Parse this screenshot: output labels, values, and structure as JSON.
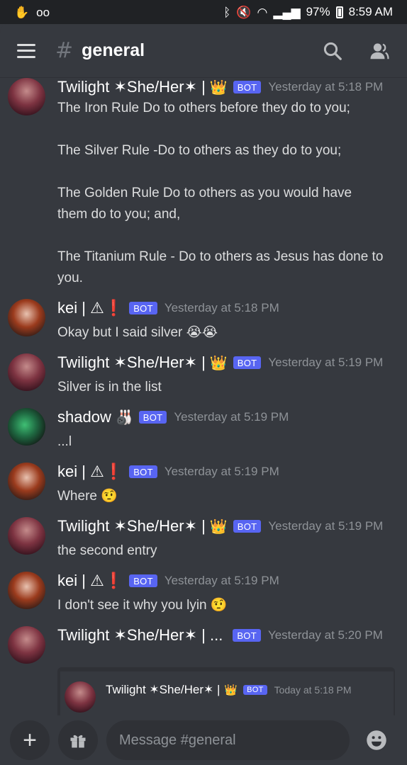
{
  "status_bar": {
    "battery": "97%",
    "time": "8:59 AM"
  },
  "header": {
    "channel_name": "general"
  },
  "messages": [
    {
      "username": "Twilight ✶She/Her✶ |",
      "badge": "BOT",
      "timestamp": "Yesterday at 5:18 PM",
      "lines": [
        "The Iron Rule Do to others before they do to you;",
        "",
        "The Silver Rule -Do to others as they do to you;",
        "",
        "The Golden Rule Do to others as you would have",
        "them do to you; and,",
        "",
        "The Titanium Rule - Do to others as Jesus has done to",
        "you."
      ]
    },
    {
      "username": "kei | ⚠❗",
      "badge": "BOT",
      "timestamp": "Yesterday at 5:18 PM",
      "text": "Okay but I said silver 😭😭"
    },
    {
      "username": "Twilight ✶She/Her✶ |",
      "badge": "BOT",
      "timestamp": "Yesterday at 5:19 PM",
      "text": "Silver is in the list"
    },
    {
      "username": "shadow",
      "badge": "BOT",
      "timestamp": "Yesterday at 5:19 PM",
      "text": "...l"
    },
    {
      "username": "kei | ⚠❗",
      "badge": "BOT",
      "timestamp": "Yesterday at 5:19 PM",
      "text": "Where 🤨"
    },
    {
      "username": "Twilight ✶She/Her✶ |",
      "badge": "BOT",
      "timestamp": "Yesterday at 5:19 PM",
      "text": "the second entry"
    },
    {
      "username": "kei | ⚠❗",
      "badge": "BOT",
      "timestamp": "Yesterday at 5:19 PM",
      "text": "I don't see it why you lyin 🤨"
    },
    {
      "username": "Twilight ✶She/Her✶ | ...",
      "badge": "BOT",
      "timestamp": "Yesterday at 5:20 PM"
    }
  ],
  "embed": {
    "username": "Twilight ✶She/Her✶ |",
    "badge": "BOT",
    "timestamp": "Today at 5:18 PM"
  },
  "composer": {
    "placeholder": "Message #general"
  },
  "colors": {
    "background": "#36393f",
    "bot_badge": "#5865f2",
    "timestamp": "#8e9297"
  }
}
